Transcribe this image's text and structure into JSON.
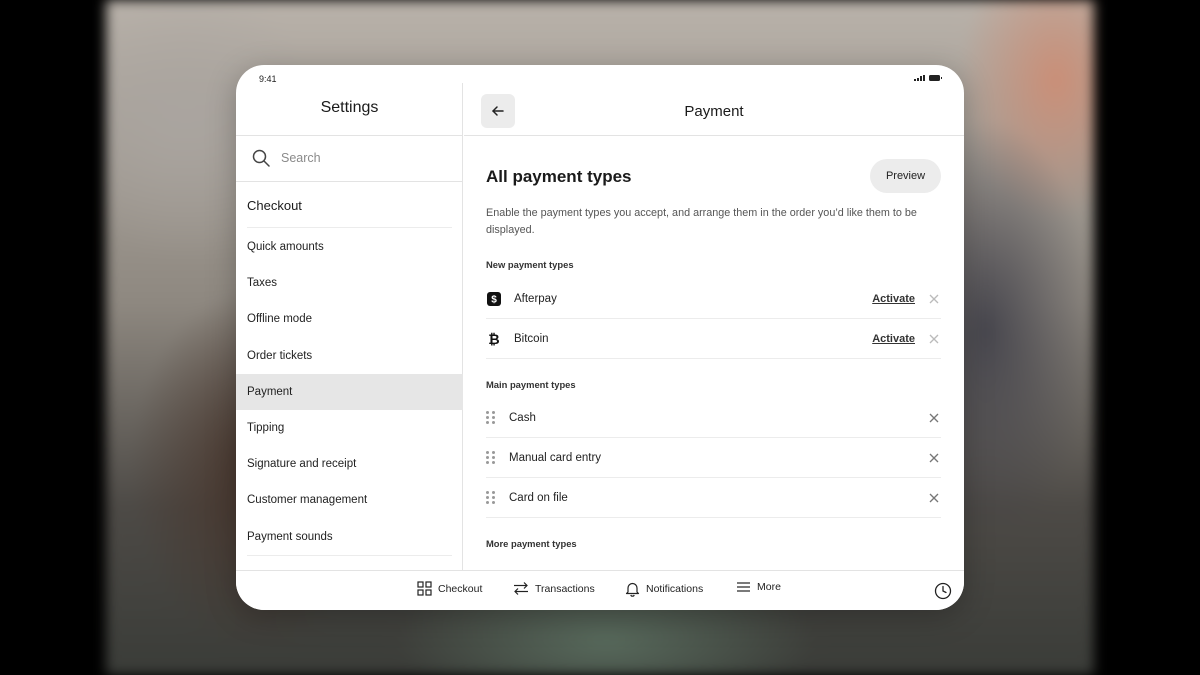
{
  "status_bar": {
    "time": "9:41"
  },
  "settings": {
    "title": "Settings",
    "search_placeholder": "Search",
    "section": "Checkout",
    "items": [
      {
        "label": "Quick amounts",
        "active": false
      },
      {
        "label": "Taxes",
        "active": false
      },
      {
        "label": "Offline mode",
        "active": false
      },
      {
        "label": "Order tickets",
        "active": false
      },
      {
        "label": "Payment",
        "active": true
      },
      {
        "label": "Tipping",
        "active": false
      },
      {
        "label": "Signature and receipt",
        "active": false
      },
      {
        "label": "Customer management",
        "active": false
      },
      {
        "label": "Payment sounds",
        "active": false
      }
    ]
  },
  "payment": {
    "title": "Payment",
    "heading": "All payment types",
    "preview_label": "Preview",
    "description": "Enable the payment types you accept, and arrange them in the order you’d like them to be displayed.",
    "new_section": "New payment types",
    "new_types": [
      {
        "label": "Afterpay",
        "icon": "afterpay-icon",
        "action": "Activate"
      },
      {
        "label": "Bitcoin",
        "icon": "bitcoin-icon",
        "action": "Activate"
      }
    ],
    "main_section": "Main payment types",
    "main_types": [
      {
        "label": "Cash"
      },
      {
        "label": "Manual card entry"
      },
      {
        "label": "Card on file"
      }
    ],
    "more_section": "More payment types"
  },
  "bottom_nav": {
    "checkout": "Checkout",
    "transactions": "Transactions",
    "notifications": "Notifications",
    "more": "More"
  }
}
